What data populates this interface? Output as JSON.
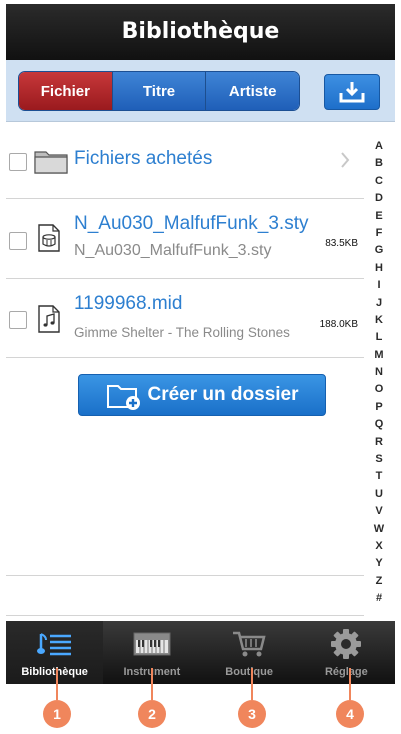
{
  "header": {
    "title": "Bibliothèque"
  },
  "segments": [
    "Fichier",
    "Titre",
    "Artiste"
  ],
  "download_icon": "download-tray-icon",
  "rows": [
    {
      "icon": "folder-icon",
      "name": "Fichiers achetés"
    },
    {
      "icon": "style-file-icon",
      "name": "N_Au030_MalfufFunk_3.sty",
      "sub": "N_Au030_MalfufFunk_3.sty",
      "size": "83.5KB"
    },
    {
      "icon": "midi-file-icon",
      "name": "1199968.mid",
      "sub": "Gimme Shelter - The Rolling Stones",
      "size": "188.0KB"
    }
  ],
  "create_button": {
    "label": "Créer un dossier"
  },
  "index_letters": [
    "A",
    "B",
    "C",
    "D",
    "E",
    "F",
    "G",
    "H",
    "I",
    "J",
    "K",
    "L",
    "M",
    "N",
    "O",
    "P",
    "Q",
    "R",
    "S",
    "T",
    "U",
    "V",
    "W",
    "X",
    "Y",
    "Z",
    "#"
  ],
  "tabs": [
    {
      "icon": "library-icon",
      "label": "Bibliothèque",
      "active": true
    },
    {
      "icon": "keyboard-icon",
      "label": "Instrument",
      "active": false
    },
    {
      "icon": "cart-icon",
      "label": "Boutique",
      "active": false
    },
    {
      "icon": "gear-icon",
      "label": "Réglage",
      "active": false
    }
  ],
  "callouts": [
    "1",
    "2",
    "3",
    "4"
  ],
  "colors": {
    "accent": "#2d7fd0",
    "selected_segment": "#b52a2d",
    "callout": "#f0865c",
    "titlebar": "#1a1a1a"
  }
}
